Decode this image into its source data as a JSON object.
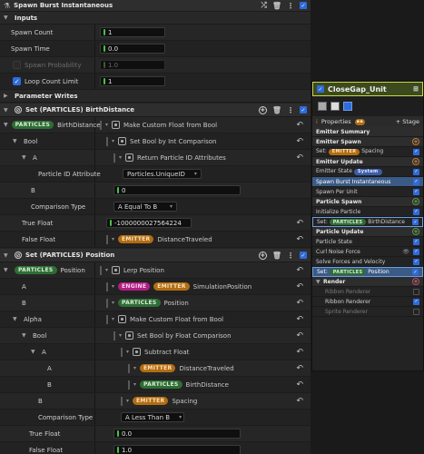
{
  "spawn_burst": {
    "title": "Spawn Burst Instantaneous",
    "inputs_label": "Inputs",
    "rows": [
      {
        "label": "Spawn Count",
        "value": "1"
      },
      {
        "label": "Spawn Time",
        "value": "0.0"
      },
      {
        "label": "Spawn Probability",
        "value": "1.0"
      },
      {
        "label": "Loop Count Limit",
        "value": "1"
      }
    ],
    "parameter_writes": "Parameter Writes"
  },
  "birth_distance": {
    "title": "Set (PARTICLES) BirthDistance",
    "rows": [
      {
        "label": "BirthDistance",
        "tag": "PARTICLES",
        "value": "Make Custom Float from Bool"
      },
      {
        "label": "Bool",
        "value": "Set Bool by Int Comparison"
      },
      {
        "label": "A",
        "value": "Return Particle ID Attributes"
      },
      {
        "label": "Particle ID Attribute",
        "value": "Particles.UniqueID"
      },
      {
        "label": "B",
        "value": "0"
      },
      {
        "label": "Comparison Type",
        "value": "A Equal To B"
      },
      {
        "label": "True Float",
        "value": "-1000000027564224"
      },
      {
        "label": "False Float",
        "tag": "EMITTER",
        "value": "DistanceTraveled"
      }
    ]
  },
  "position": {
    "title": "Set (PARTICLES) Position",
    "rows": [
      {
        "label": "Position",
        "tag": "PARTICLES",
        "value": "Lerp Position"
      },
      {
        "label": "A",
        "tag1": "ENGINE",
        "tag2": "EMITTER",
        "value": "SimulationPosition"
      },
      {
        "label": "B",
        "tag": "PARTICLES",
        "value": "Position"
      },
      {
        "label": "Alpha",
        "value": "Make Custom Float from Bool"
      },
      {
        "label": "Bool",
        "value": "Set Bool by Float Comparison"
      },
      {
        "label": "A",
        "value": "Subtract Float"
      },
      {
        "label": "A",
        "tag": "EMITTER",
        "value": "DistanceTraveled"
      },
      {
        "label": "B",
        "tag": "PARTICLES",
        "value": "BirthDistance"
      },
      {
        "label": "B",
        "tag": "EMITTER",
        "value": "Spacing"
      },
      {
        "label": "Comparison Type",
        "value": "A Less Than B"
      },
      {
        "label": "True Float",
        "value": "0.0"
      },
      {
        "label": "False Float",
        "value": "1.0"
      }
    ]
  },
  "node": {
    "title": "CloseGap_Unit",
    "tab_properties": "Properties",
    "tab_stage": "Stage",
    "items": [
      {
        "text": "Emitter Summary",
        "kind": "group"
      },
      {
        "text": "Emitter Spawn",
        "kind": "group"
      },
      {
        "text": "Set:",
        "tag": "EMITTER",
        "tail": "Spacing",
        "kind": "item"
      },
      {
        "text": "Emitter Update",
        "kind": "group"
      },
      {
        "text": "Emitter State",
        "tag": "System",
        "kind": "item"
      },
      {
        "text": "Spawn Burst Instantaneous",
        "kind": "hl"
      },
      {
        "text": "Spawn Per Unit",
        "kind": "item"
      },
      {
        "text": "Particle Spawn",
        "kind": "group"
      },
      {
        "text": "Initialize Particle",
        "kind": "item"
      },
      {
        "text": "Set:",
        "tag": "PARTICLES",
        "tail": "BirthDistance",
        "kind": "sel"
      },
      {
        "text": "Particle Update",
        "kind": "group"
      },
      {
        "text": "Particle State",
        "kind": "item"
      },
      {
        "text": "Curl Noise Force",
        "kind": "item"
      },
      {
        "text": "Solve Forces and Velocity",
        "kind": "item"
      },
      {
        "text": "Set:",
        "tag": "PARTICLES",
        "tail": "Position",
        "kind": "hlsel"
      },
      {
        "text": "Render",
        "kind": "group"
      },
      {
        "text": "Ribbon Renderer",
        "kind": "dim"
      },
      {
        "text": "Ribbon Renderer",
        "kind": "item"
      },
      {
        "text": "Sprite Renderer",
        "kind": "dim"
      }
    ]
  }
}
